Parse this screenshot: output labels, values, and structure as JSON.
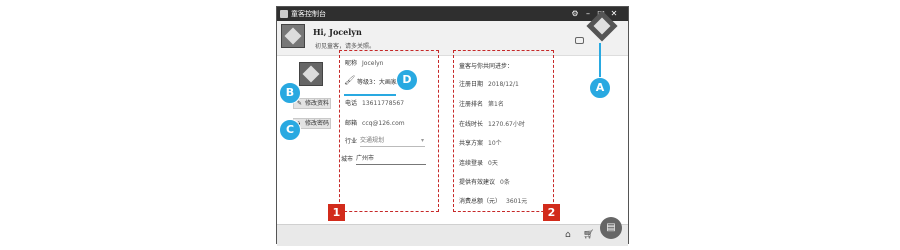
{
  "window": {
    "title": "童客控制台"
  },
  "header": {
    "greeting": "Hi, Jocelyn",
    "subtitle": "初见童客，请多关照。"
  },
  "sidebar": {
    "edit_profile": "修改资料",
    "change_password": "修改密码"
  },
  "profile": {
    "nickname_label": "昵称",
    "nickname": "Jocelyn",
    "signature": "等级3：大画家",
    "phone_label": "电话",
    "phone": "13611778567",
    "email_label": "邮箱",
    "email": "ccq@126.com",
    "industry_label": "行业",
    "industry": "交通规划",
    "city_label": "城市",
    "city": "广州市"
  },
  "stats": {
    "title": "童客与你共同进步：",
    "rows": [
      {
        "label": "注册日期",
        "value": "2018/12/1"
      },
      {
        "label": "注册排名",
        "value": "第1名"
      },
      {
        "label": "在线时长",
        "value": "1270.67小时"
      },
      {
        "label": "共享方案",
        "value": "10个"
      },
      {
        "label": "连续登录",
        "value": "0天"
      },
      {
        "label": "提供有效建议",
        "value": "0条"
      },
      {
        "label": "消费总额（元）",
        "value": "3601元"
      }
    ]
  },
  "annotations": {
    "a": "A",
    "b": "B",
    "c": "C",
    "d": "D",
    "one": "1",
    "two": "2"
  },
  "icons": [
    "settings-icon",
    "minimize-icon",
    "maximize-icon",
    "close-icon",
    "message-icon",
    "brush-icon",
    "lock-icon",
    "store-icon",
    "cart-icon",
    "document-icon"
  ],
  "colors": {
    "accent": "#29a9e1",
    "marker": "#d22b1b",
    "dashed": "#c62828",
    "titlebar": "#2f2f2f"
  }
}
